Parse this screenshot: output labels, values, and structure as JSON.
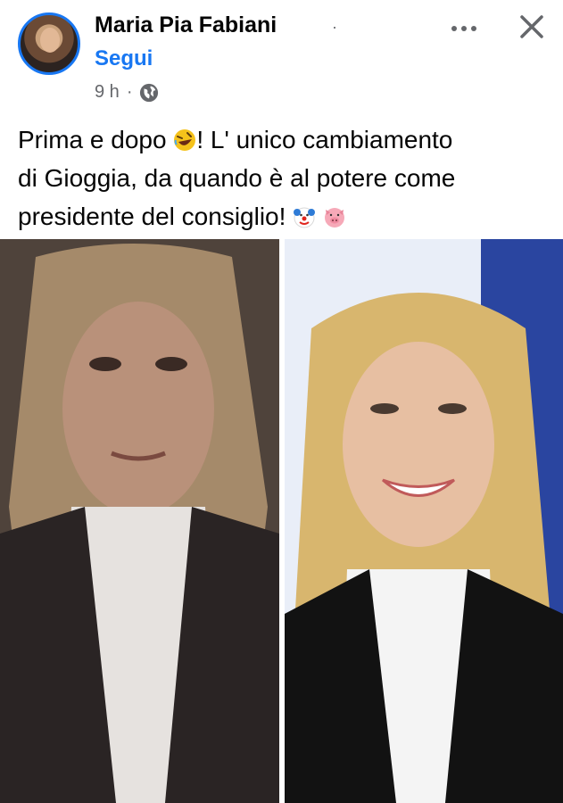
{
  "post": {
    "author": "Maria Pia Fabiani",
    "separator": "·",
    "follow_label": "Segui",
    "time": "9 h",
    "time_separator": "·",
    "audience_icon": "globe-icon",
    "caption_lines": [
      "Prima e dopo",
      "! L' unico cambiamento",
      "di Gioggia, da quando è al potere come",
      "presidente del consiglio!"
    ],
    "caption_emojis": [
      "rolling-laughing-emoji",
      "clown-face-emoji",
      "pig-face-emoji"
    ],
    "photos": [
      {
        "name": "photo-before"
      },
      {
        "name": "photo-after"
      }
    ]
  },
  "colors": {
    "accent": "#1877f2",
    "text": "#050505",
    "secondary": "#65676b",
    "background": "#ffffff"
  },
  "icons": {
    "more": "more-options-icon",
    "close": "close-icon"
  }
}
